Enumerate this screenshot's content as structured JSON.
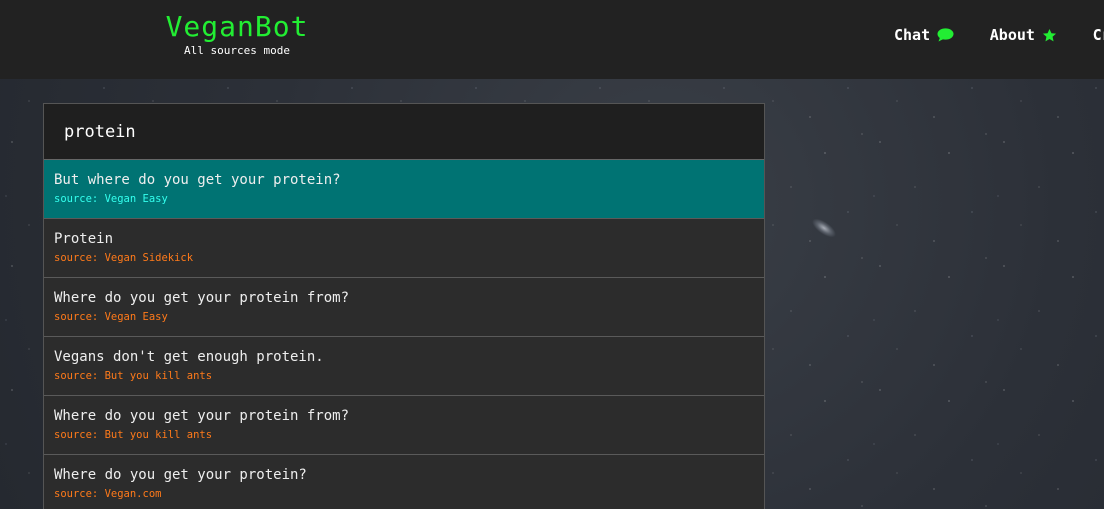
{
  "brand": {
    "title": "VeganBot",
    "subtitle": "All sources mode"
  },
  "nav": {
    "items": [
      {
        "label": "Chat",
        "icon": "speech-bubble-icon"
      },
      {
        "label": "About",
        "icon": "star-icon"
      },
      {
        "label": "Cr",
        "icon": ""
      }
    ]
  },
  "search": {
    "value": "protein"
  },
  "results": [
    {
      "question": "But where do you get your protein?",
      "source": "source: Vegan Easy",
      "active": true
    },
    {
      "question": "Protein",
      "source": "source: Vegan Sidekick",
      "active": false
    },
    {
      "question": "Where do you get your protein from?",
      "source": "source: Vegan Easy",
      "active": false
    },
    {
      "question": "Vegans don't get enough protein.",
      "source": "source: But you kill ants",
      "active": false
    },
    {
      "question": "Where do you get your protein from?",
      "source": "source: But you kill ants",
      "active": false
    },
    {
      "question": "Where do you get your protein?",
      "source": "source: Vegan.com",
      "active": false
    }
  ],
  "colors": {
    "accent_green": "#22ee33",
    "active_row": "#007373",
    "source_orange": "#ff7a1a",
    "source_active_cyan": "#33ffee",
    "navbar": "#222222"
  }
}
